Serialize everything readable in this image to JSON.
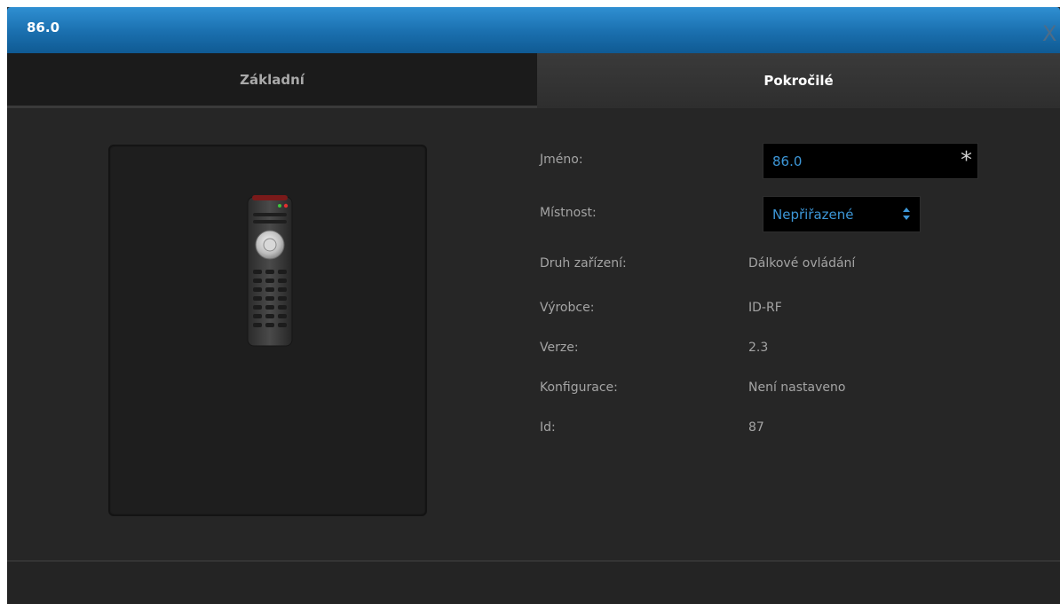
{
  "window": {
    "title": "86.0",
    "close_label": "X"
  },
  "tabs": [
    {
      "label": "Základní",
      "active": false
    },
    {
      "label": "Pokročilé",
      "active": true
    }
  ],
  "device_image": {
    "icon": "remote-control-icon"
  },
  "properties": {
    "name": {
      "label": "Jméno:",
      "value": "86.0"
    },
    "room": {
      "label": "Místnost:",
      "value": "Nepřiřazené"
    },
    "device_type": {
      "label": "Druh zařízení:",
      "value": "Dálkové ovládání"
    },
    "manufacturer": {
      "label": "Výrobce:",
      "value": "ID-RF"
    },
    "version": {
      "label": "Verze:",
      "value": "2.3"
    },
    "configuration": {
      "label": "Konfigurace:",
      "value": "Není nastaveno"
    },
    "id": {
      "label": "Id:",
      "value": "87"
    }
  },
  "colors": {
    "accent": "#3d97d8",
    "titlebar": "#1a6fae",
    "background": "#262626"
  }
}
